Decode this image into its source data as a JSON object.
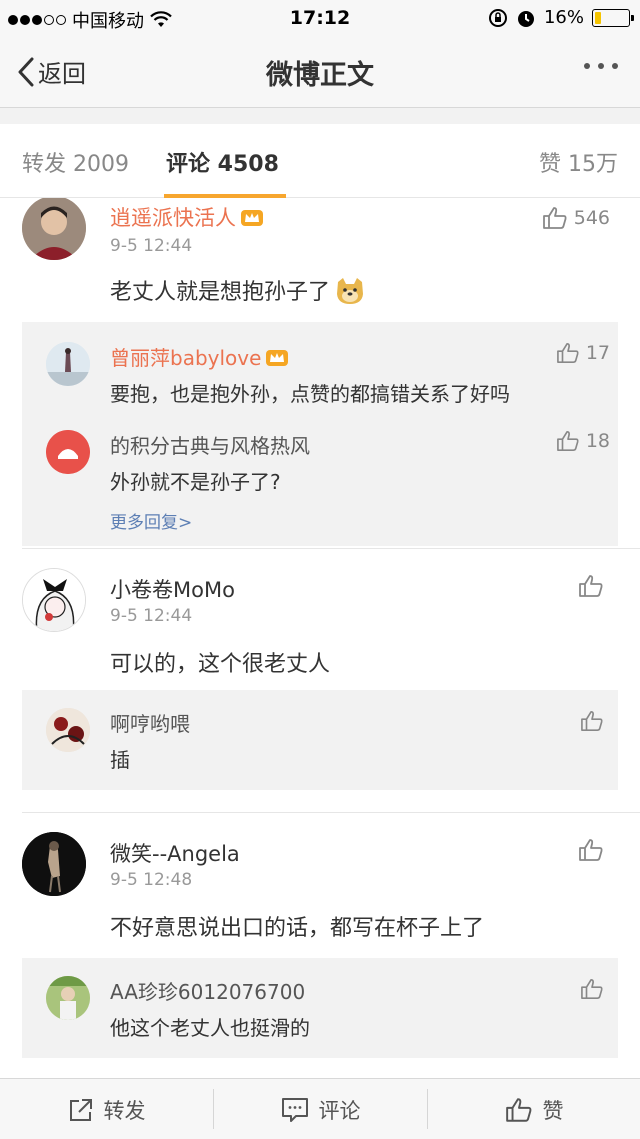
{
  "status": {
    "carrier": "中国移动",
    "time": "17:12",
    "battery": "16%",
    "battery_level": 0.16
  },
  "nav": {
    "back_label": "返回",
    "title": "微博正文"
  },
  "tabs": {
    "repost": "转发 2009",
    "comment": "评论 4508",
    "likes": "赞 15万"
  },
  "comments": [
    {
      "name": "逍遥派快活人",
      "date": "9-5 12:44",
      "text": "老丈人就是想抱孙子了",
      "likes": "546",
      "replies": [
        {
          "name": "曾丽萍babylove",
          "text": "要抱，也是抱外孙，点赞的都搞错关系了好吗",
          "likes": "17"
        },
        {
          "name": "的积分古典与风格热风",
          "text": "外孙就不是孙子了?",
          "likes": "18"
        }
      ],
      "more_replies": "更多回复>"
    },
    {
      "name": "小卷卷MoMo",
      "date": "9-5 12:44",
      "text": "可以的，这个很老丈人",
      "likes": "",
      "replies": [
        {
          "name": "啊哼哟喂",
          "text": "插",
          "likes": ""
        }
      ]
    },
    {
      "name": "微笑--Angela",
      "date": "9-5 12:48",
      "text": "不好意思说出口的话，都写在杯子上了",
      "likes": "",
      "replies": [
        {
          "name": "AA珍珍6012076700",
          "text": "他这个老丈人也挺滑的",
          "likes": ""
        }
      ]
    }
  ],
  "toolbar": {
    "repost": "转发",
    "comment": "评论",
    "like": "赞"
  },
  "colors": {
    "accent": "#f7a62e",
    "vip_name": "#eb7350",
    "link": "#5d7fb4"
  }
}
